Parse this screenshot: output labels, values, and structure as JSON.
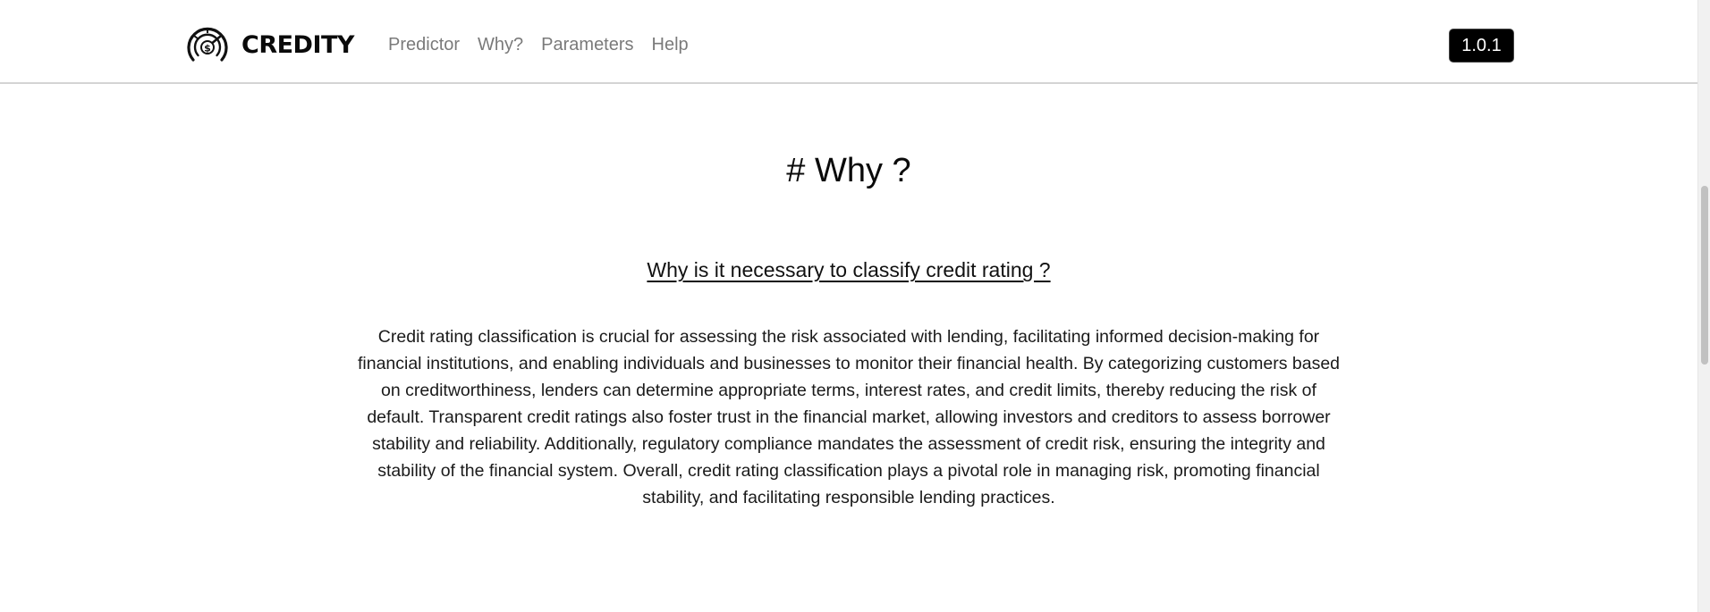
{
  "app": {
    "brand_name": "CREDITY",
    "version": "1.0.1"
  },
  "nav": {
    "items": [
      {
        "label": "Predictor"
      },
      {
        "label": "Why?"
      },
      {
        "label": "Parameters"
      },
      {
        "label": "Help"
      }
    ]
  },
  "main": {
    "title": "# Why ?",
    "section_heading": "Why is it necessary to classify credit rating ?",
    "body": "Credit rating classification is crucial for assessing the risk associated with lending, facilitating informed decision-making for financial institutions, and enabling individuals and businesses to monitor their financial health. By categorizing customers based on creditworthiness, lenders can determine appropriate terms, interest rates, and credit limits, thereby reducing the risk of default. Transparent credit ratings also foster trust in the financial market, allowing investors and creditors to assess borrower stability and reliability. Additionally, regulatory compliance mandates the assessment of credit risk, ensuring the integrity and stability of the financial system. Overall, credit rating classification plays a pivotal role in managing risk, promoting financial stability, and facilitating responsible lending practices."
  },
  "icons": {
    "logo": "credit-gauge-dollar-icon"
  },
  "colors": {
    "nav_link": "#7a7a7a",
    "badge_bg": "#000000",
    "badge_text": "#ffffff",
    "divider": "#d4d4d4"
  }
}
